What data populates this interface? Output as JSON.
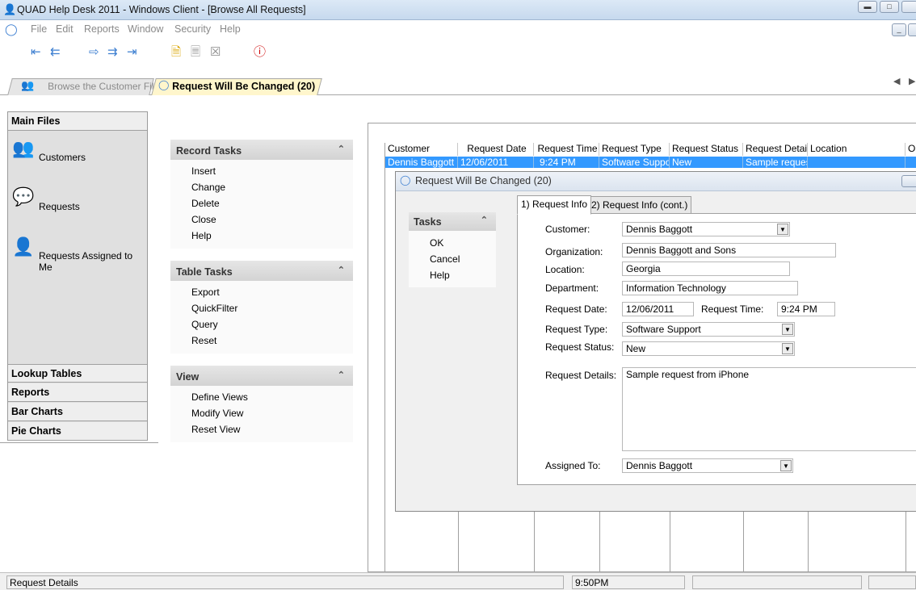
{
  "window": {
    "title": "QUAD Help Desk 2011 - Windows Client - [Browse All Requests]"
  },
  "menu": [
    "File",
    "Edit",
    "Reports",
    "Window",
    "Security",
    "Help"
  ],
  "tabs": {
    "tab1": "Browse the Customer File",
    "tab2": "Request Will Be Changed  (20)"
  },
  "left": {
    "main_files": "Main Files",
    "items": [
      "Customers",
      "Requests",
      "Requests Assigned to Me"
    ],
    "sections": [
      "Lookup Tables",
      "Reports",
      "Bar Charts",
      "Pie Charts"
    ]
  },
  "record_tasks": {
    "title": "Record Tasks",
    "items": [
      "Insert",
      "Change",
      "Delete",
      "Close",
      "Help"
    ]
  },
  "table_tasks": {
    "title": "Table Tasks",
    "items": [
      "Export",
      "QuickFilter",
      "Query",
      "Reset"
    ]
  },
  "view": {
    "title": "View",
    "items": [
      "Define Views",
      "Modify View",
      "Reset View"
    ]
  },
  "grid": {
    "headers": [
      "Customer",
      "Request Date",
      "Request Time",
      "Request Type",
      "Request Status",
      "Request Details",
      "Location",
      "Or"
    ],
    "row": [
      "Dennis Baggott",
      "12/06/2011",
      "9:24 PM",
      "Software Support",
      "New",
      "Sample request",
      ""
    ]
  },
  "dialog": {
    "title": "Request Will Be Changed  (20)",
    "tasks": {
      "title": "Tasks",
      "items": [
        "OK",
        "Cancel",
        "Help"
      ]
    },
    "tabs": [
      "1) Request Info",
      "2) Request Info (cont.)"
    ],
    "labels": {
      "customer": "Customer:",
      "organization": "Organization:",
      "location": "Location:",
      "department": "Department:",
      "request_date": "Request Date:",
      "request_time": "Request Time:",
      "request_type": "Request Type:",
      "request_status": "Request Status:",
      "request_details": "Request Details:",
      "assigned_to": "Assigned To:"
    },
    "values": {
      "customer": "Dennis Baggott",
      "organization": "Dennis Baggott and Sons",
      "location": "Georgia",
      "department": "Information Technology",
      "request_date": "12/06/2011",
      "request_time": "9:24 PM",
      "request_type": "Software Support",
      "request_status": "New",
      "request_details": "Sample request from iPhone",
      "assigned_to": "Dennis Baggott"
    }
  },
  "status": {
    "left": "Request Details",
    "time": "9:50PM"
  },
  "colors": {
    "selection": "#3399ff",
    "tab_active": "#fff6cc"
  }
}
